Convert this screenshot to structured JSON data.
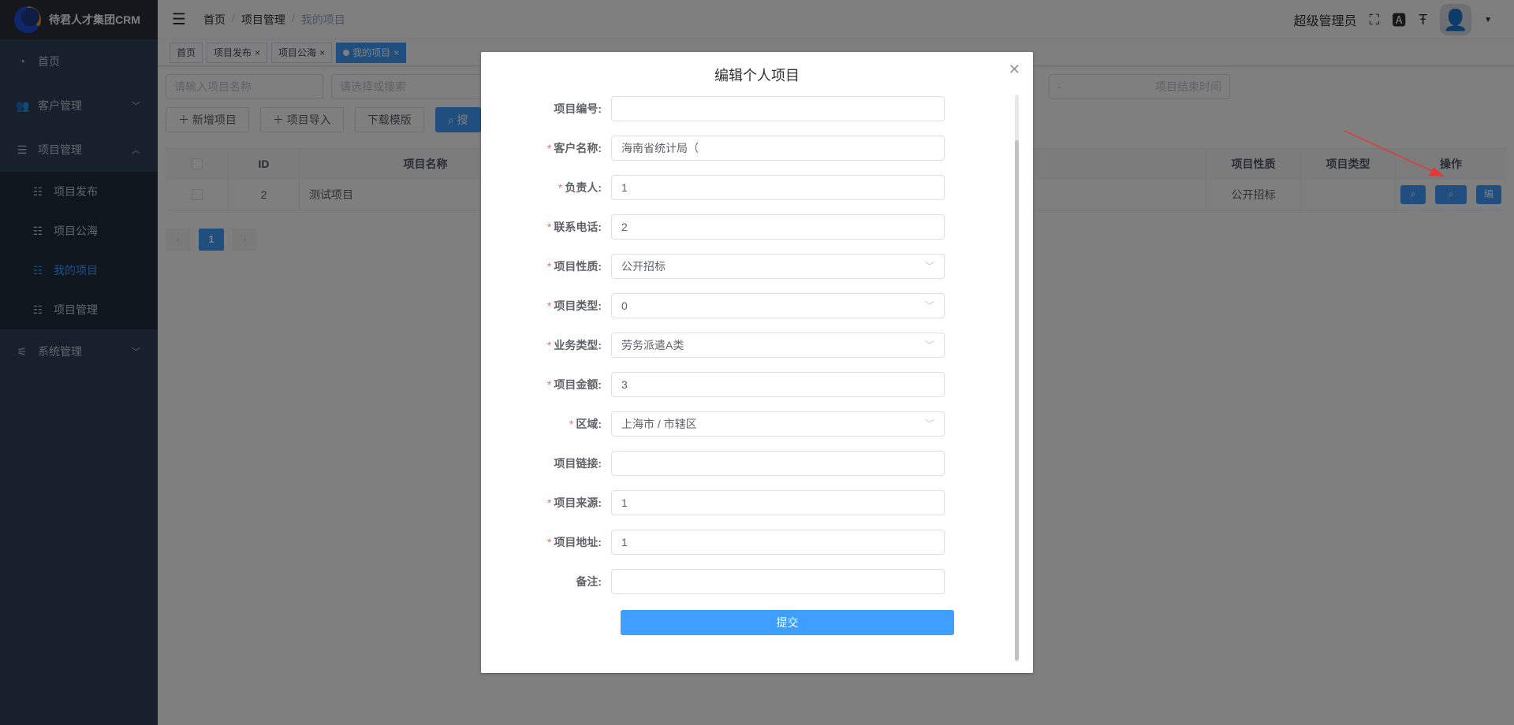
{
  "app": {
    "logo_text": "待君人才集团CRM"
  },
  "sidebar": {
    "items": [
      {
        "label": "首页",
        "icon": "dashboard-icon"
      },
      {
        "label": "客户管理",
        "icon": "users-icon"
      },
      {
        "label": "项目管理",
        "icon": "list-icon"
      }
    ],
    "sub_items": [
      {
        "label": "项目发布"
      },
      {
        "label": "项目公海"
      },
      {
        "label": "我的项目"
      },
      {
        "label": "项目管理"
      }
    ],
    "system": {
      "label": "系统管理",
      "icon": "sliders-icon"
    }
  },
  "navbar": {
    "breadcrumb": [
      "首页",
      "项目管理",
      "我的项目"
    ],
    "user_name": "超级管理员"
  },
  "tags": [
    {
      "label": "首页"
    },
    {
      "label": "项目发布"
    },
    {
      "label": "项目公海"
    },
    {
      "label": "我的项目"
    }
  ],
  "filters": {
    "project_name_placeholder": "请输入项目名称",
    "select_placeholder": "请选择或搜索",
    "range_sep": "-",
    "end_time_placeholder": "项目结束时间"
  },
  "actions": {
    "add": "新增项目",
    "import": "项目导入",
    "download": "下载模版",
    "search": "搜"
  },
  "table": {
    "headers": {
      "id": "ID",
      "name": "项目名称",
      "nature": "项目性质",
      "type": "项目类型",
      "ops": "操作"
    },
    "row": {
      "id": "2",
      "name": "测试项目",
      "nature": "公开招标"
    },
    "buttons": {
      "view": "查看",
      "follow": "项目跟进",
      "edit": "编辑"
    }
  },
  "pager": {
    "current": "1"
  },
  "dialog": {
    "title": "编辑个人项目",
    "fields": [
      {
        "label": "项目编号:",
        "required": false,
        "value": ""
      },
      {
        "label": "客户名称:",
        "required": true,
        "value": "海南省统计局（"
      },
      {
        "label": "负责人:",
        "required": true,
        "value": "1"
      },
      {
        "label": "联系电话:",
        "required": true,
        "value": "2"
      },
      {
        "label": "项目性质:",
        "required": true,
        "value": "公开招标",
        "select": true
      },
      {
        "label": "项目类型:",
        "required": true,
        "value": "0",
        "select": true
      },
      {
        "label": "业务类型:",
        "required": true,
        "value": "劳务派遣A类",
        "select": true
      },
      {
        "label": "项目金额:",
        "required": true,
        "value": "3"
      },
      {
        "label": "区域:",
        "required": true,
        "value": "上海市 / 市辖区",
        "select": true
      },
      {
        "label": "项目链接:",
        "required": false,
        "value": ""
      },
      {
        "label": "项目来源:",
        "required": true,
        "value": "1"
      },
      {
        "label": "项目地址:",
        "required": true,
        "value": "1"
      },
      {
        "label": "备注:",
        "required": false,
        "value": ""
      }
    ],
    "submit": "提交"
  },
  "colors": {
    "primary": "#409eff",
    "sidebar_bg": "#304156",
    "required": "#f56c6c",
    "arrow": "#e53935"
  }
}
